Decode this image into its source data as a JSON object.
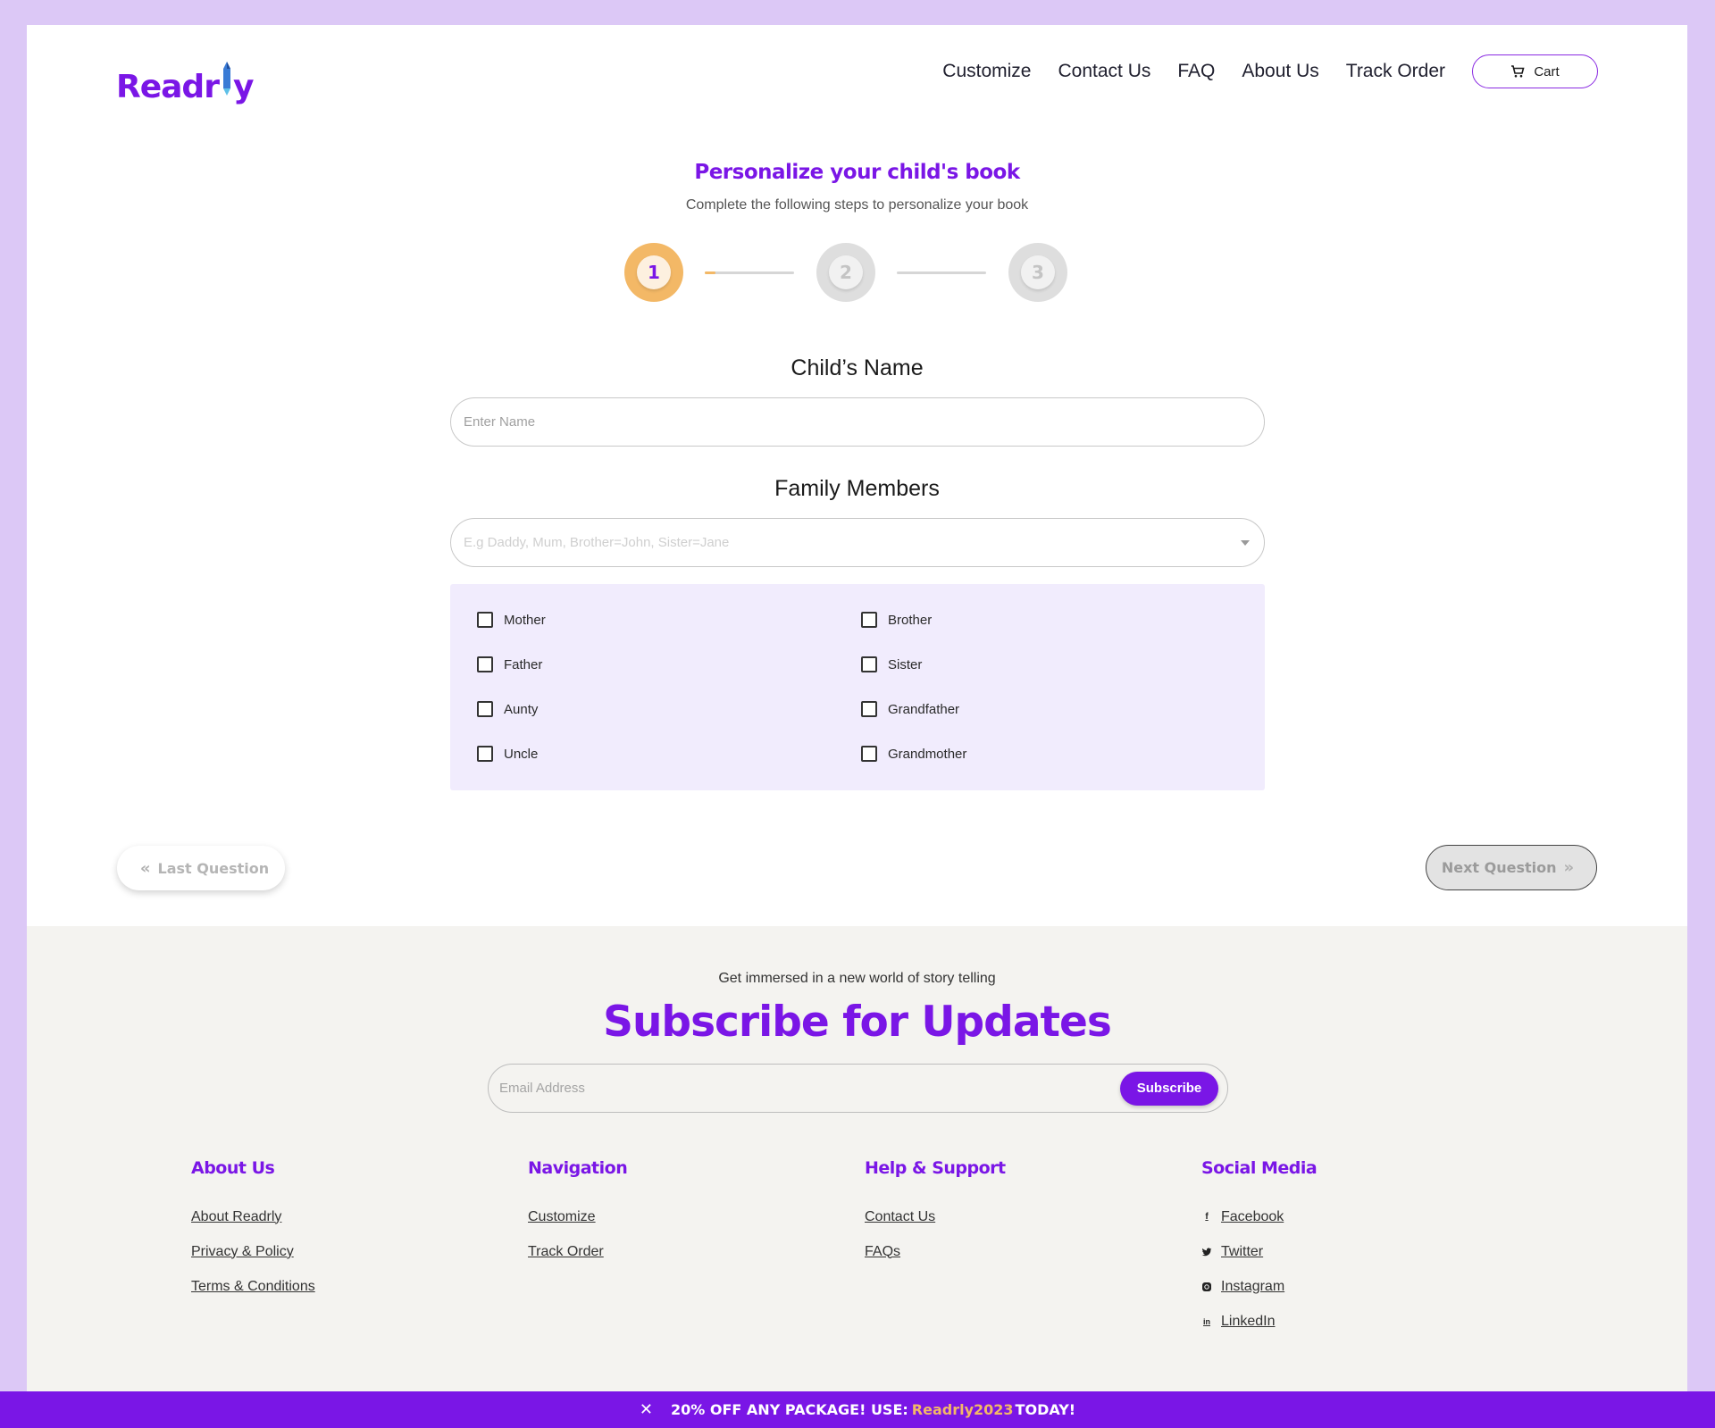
{
  "brand": {
    "name": "Readr",
    "name_tail": "y",
    "accent": "#7a16e6"
  },
  "nav": {
    "items": [
      "Customize",
      "Contact Us",
      "FAQ",
      "About Us",
      "Track Order"
    ],
    "cart_label": "Cart"
  },
  "hero": {
    "title": "Personalize your child's book",
    "subtitle": "Complete the following steps to personalize your book"
  },
  "stepper": {
    "steps": [
      "1",
      "2",
      "3"
    ],
    "current": 1,
    "progress_to_step2": 0.12
  },
  "form": {
    "child_name_label": "Child’s Name",
    "child_name_placeholder": "Enter Name",
    "child_name_value": "",
    "family_label": "Family Members",
    "family_placeholder": "E.g Daddy, Mum, Brother=John, Sister=Jane",
    "family_options_left": [
      "Mother",
      "Father",
      "Aunty",
      "Uncle"
    ],
    "family_options_right": [
      "Brother",
      "Sister",
      "Grandfather",
      "Grandmother"
    ]
  },
  "buttons": {
    "prev": "Last Question",
    "next": "Next Question"
  },
  "subscribe": {
    "tagline": "Get immersed in a new world of story telling",
    "title": "Subscribe for Updates",
    "email_placeholder": "Email Address",
    "button": "Subscribe"
  },
  "footer": {
    "about": {
      "heading": "About Us",
      "links": [
        "About Readrly",
        "Privacy & Policy",
        "Terms & Conditions"
      ]
    },
    "navigation": {
      "heading": "Navigation",
      "links": [
        "Customize",
        "Track Order"
      ]
    },
    "help": {
      "heading": "Help & Support",
      "links": [
        "Contact Us",
        "FAQs"
      ]
    },
    "social": {
      "heading": "Social Media",
      "links": [
        "Facebook",
        "Twitter",
        "Instagram",
        "LinkedIn"
      ],
      "icons": [
        "facebook-icon",
        "twitter-icon",
        "instagram-icon",
        "linkedin-icon"
      ]
    }
  },
  "promo": {
    "prefix": "20% OFF ANY PACKAGE! USE:",
    "code": "Readrly2023",
    "suffix": "TODAY!"
  }
}
